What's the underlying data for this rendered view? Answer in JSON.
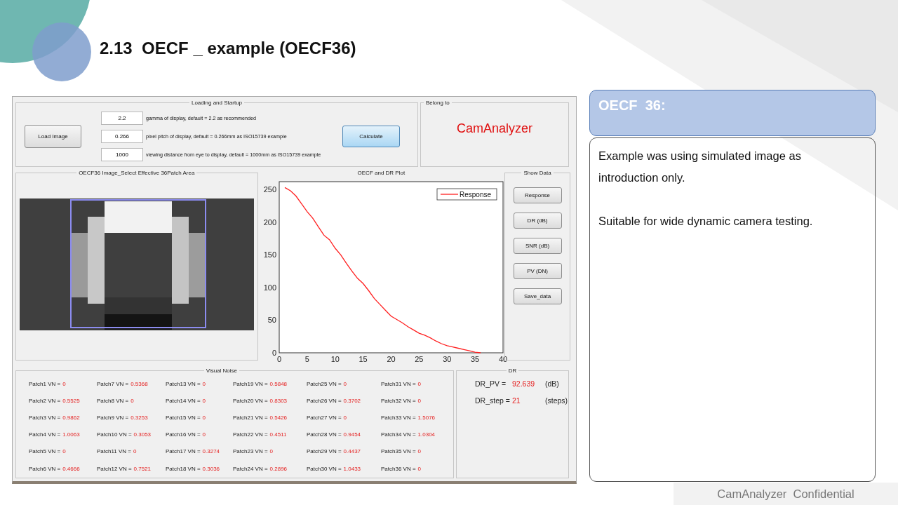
{
  "slide": {
    "title": "2.13  OECF _ example (OECF36)",
    "footer": "CamAnalyzer  Confidential"
  },
  "app": {
    "loading_panel": {
      "title": "Loading and Startup",
      "load_button": "Load Image",
      "calculate_button": "Calculate",
      "fields": [
        {
          "value": "2.2",
          "description": "gamma of display, default = 2.2 as recommended"
        },
        {
          "value": "0.266",
          "description": "pixel pitch of display, default = 0.266mm as ISO15739 example"
        },
        {
          "value": "1000",
          "description": "viewing distance from eye to display, default = 1000mm as ISO15739 example"
        }
      ]
    },
    "belong_panel": {
      "title": "Belong to",
      "name": "CamAnalyzer"
    },
    "image_panel": {
      "title": "OECF36 Image_Select Effective 36Patch Area"
    },
    "plot_panel": {
      "title": "OECF and DR Plot",
      "chart_data": {
        "type": "line",
        "x": [
          1,
          2,
          3,
          4,
          5,
          6,
          7,
          8,
          9,
          10,
          11,
          12,
          13,
          14,
          15,
          16,
          17,
          18,
          19,
          20,
          21,
          22,
          23,
          24,
          25,
          26,
          27,
          28,
          29,
          30,
          31,
          32,
          33,
          34,
          35,
          36
        ],
        "series": [
          {
            "name": "Response",
            "color": "#ff2020",
            "values": [
              253,
              248,
              240,
              228,
              216,
              206,
              193,
              180,
              173,
              160,
              150,
              137,
              125,
              114,
              106,
              95,
              83,
              74,
              65,
              56,
              51,
              46,
              40,
              35,
              30,
              27,
              23,
              18,
              14,
              11,
              9,
              7,
              5,
              3,
              1,
              0
            ]
          }
        ],
        "xlim": [
          0,
          40
        ],
        "ylim": [
          0,
          262
        ],
        "xticks": [
          0,
          5,
          10,
          15,
          20,
          25,
          30,
          35,
          40
        ],
        "yticks": [
          0,
          50,
          100,
          150,
          200,
          250
        ]
      }
    },
    "show_data": {
      "title": "Show Data",
      "buttons": [
        "Response",
        "DR (dB)",
        "SNR (dB)",
        "PV (DN)",
        "Save_data"
      ]
    },
    "visual_noise": {
      "title": "Visual Noise",
      "items": [
        {
          "label": "Patch1 VN =",
          "value": "0"
        },
        {
          "label": "Patch2 VN =",
          "value": "0.5525"
        },
        {
          "label": "Patch3 VN =",
          "value": "0.9862"
        },
        {
          "label": "Patch4 VN =",
          "value": "1.0063"
        },
        {
          "label": "Patch5 VN =",
          "value": "0"
        },
        {
          "label": "Patch6 VN =",
          "value": "0.4666"
        },
        {
          "label": "Patch7 VN =",
          "value": "0.5368"
        },
        {
          "label": "Patch8 VN =",
          "value": "0"
        },
        {
          "label": "Patch9 VN =",
          "value": "0.3253"
        },
        {
          "label": "Patch10 VN =",
          "value": "0.3053"
        },
        {
          "label": "Patch11 VN =",
          "value": "0"
        },
        {
          "label": "Patch12 VN =",
          "value": "0.7521"
        },
        {
          "label": "Patch13 VN =",
          "value": "0"
        },
        {
          "label": "Patch14 VN =",
          "value": "0"
        },
        {
          "label": "Patch15 VN =",
          "value": "0"
        },
        {
          "label": "Patch16 VN =",
          "value": "0"
        },
        {
          "label": "Patch17 VN =",
          "value": "0.3274"
        },
        {
          "label": "Patch18 VN =",
          "value": "0.3036"
        },
        {
          "label": "Patch19 VN =",
          "value": "0.5848"
        },
        {
          "label": "Patch20 VN =",
          "value": "0.8303"
        },
        {
          "label": "Patch21 VN =",
          "value": "0.5426"
        },
        {
          "label": "Patch22 VN =",
          "value": "0.4511"
        },
        {
          "label": "Patch23 VN =",
          "value": "0"
        },
        {
          "label": "Patch24 VN =",
          "value": "0.2896"
        },
        {
          "label": "Patch25 VN =",
          "value": "0"
        },
        {
          "label": "Patch26 VN =",
          "value": "0.3702"
        },
        {
          "label": "Patch27 VN =",
          "value": "0"
        },
        {
          "label": "Patch28 VN =",
          "value": "0.9454"
        },
        {
          "label": "Patch29 VN =",
          "value": "0.4437"
        },
        {
          "label": "Patch30 VN =",
          "value": "1.0433"
        },
        {
          "label": "Patch31 VN =",
          "value": "0"
        },
        {
          "label": "Patch32 VN =",
          "value": "0"
        },
        {
          "label": "Patch33 VN =",
          "value": "1.5076"
        },
        {
          "label": "Patch34 VN =",
          "value": "1.0304"
        },
        {
          "label": "Patch35 VN =",
          "value": "0"
        },
        {
          "label": "Patch36 VN =",
          "value": "0"
        }
      ]
    },
    "dr_panel": {
      "title": "DR",
      "rows": [
        {
          "label": "DR_PV =",
          "value": "92.639",
          "unit": "(dB)"
        },
        {
          "label": "DR_step =",
          "value": "21",
          "unit": "(steps)"
        }
      ]
    }
  },
  "info_card": {
    "title": "OECF  36:",
    "paragraphs": [
      "Example was using simulated image as introduction only.",
      "Suitable for wide dynamic camera testing."
    ]
  }
}
